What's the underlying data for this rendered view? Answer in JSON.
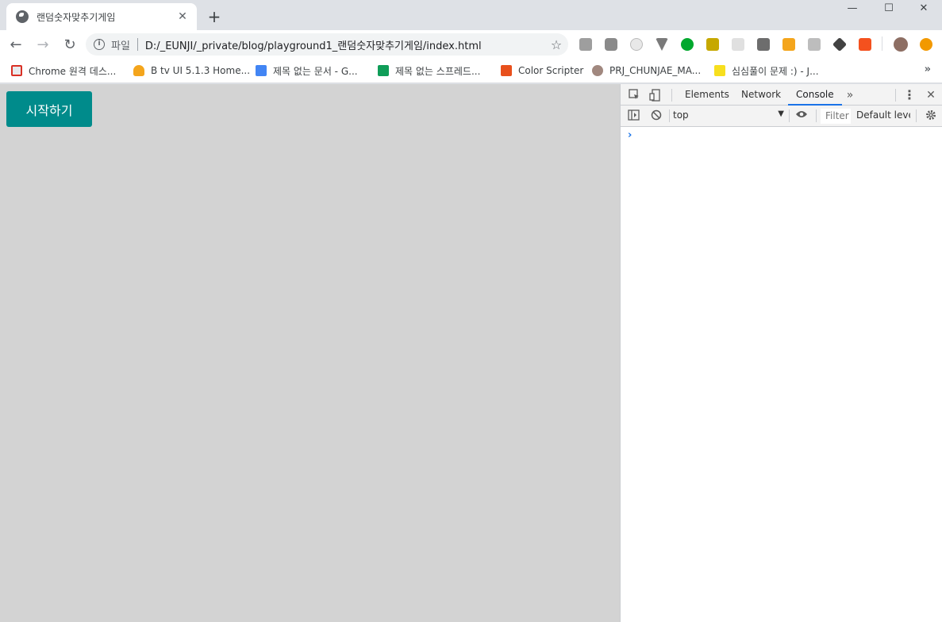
{
  "tab": {
    "title": "랜덤숫자맞추기게임",
    "close": "✕"
  },
  "newtab": "+",
  "window_controls": {
    "minimize": "—",
    "maximize": "☐",
    "close": "✕"
  },
  "toolbar": {
    "back": "←",
    "forward": "→",
    "reload": "↻",
    "info": "i",
    "scheme": "파일",
    "url": "D:/_EUNJI/_private/blog/playground1_랜덤숫자맞추기게임/index.html",
    "star": "☆"
  },
  "extensions": [
    "ex-icon",
    "camera-icon",
    "dial-icon",
    "vivaldi-icon",
    "evernote-icon",
    "ladder-icon",
    "grid-icon",
    "window-icon",
    "hex-icon",
    "js-search-icon",
    "cube-icon",
    "translate-icon"
  ],
  "colors": {
    "accent": "#008b8b",
    "page_bg": "#d3d3d3",
    "devtools_active": "#1a73e8"
  },
  "bookmarks": {
    "items": [
      {
        "label": "Chrome 원격 데스..."
      },
      {
        "label": "B tv UI 5.1.3 Home..."
      },
      {
        "label": "제목 없는 문서 - G..."
      },
      {
        "label": "제목 없는 스프레드..."
      },
      {
        "label": "Color Scripter"
      },
      {
        "label": "PRJ_CHUNJAE_MA..."
      },
      {
        "label": "심심풀이 문제 :) - J..."
      }
    ],
    "more": "»"
  },
  "page": {
    "start_button": "시작하기"
  },
  "devtools": {
    "tabs": [
      "Elements",
      "Network",
      "Console"
    ],
    "more": "»",
    "menu": "⋮",
    "close": "✕",
    "context": "top",
    "context_arrow": "▼",
    "filter_placeholder": "Filter",
    "levels": "Default levels",
    "prompt": "›"
  }
}
